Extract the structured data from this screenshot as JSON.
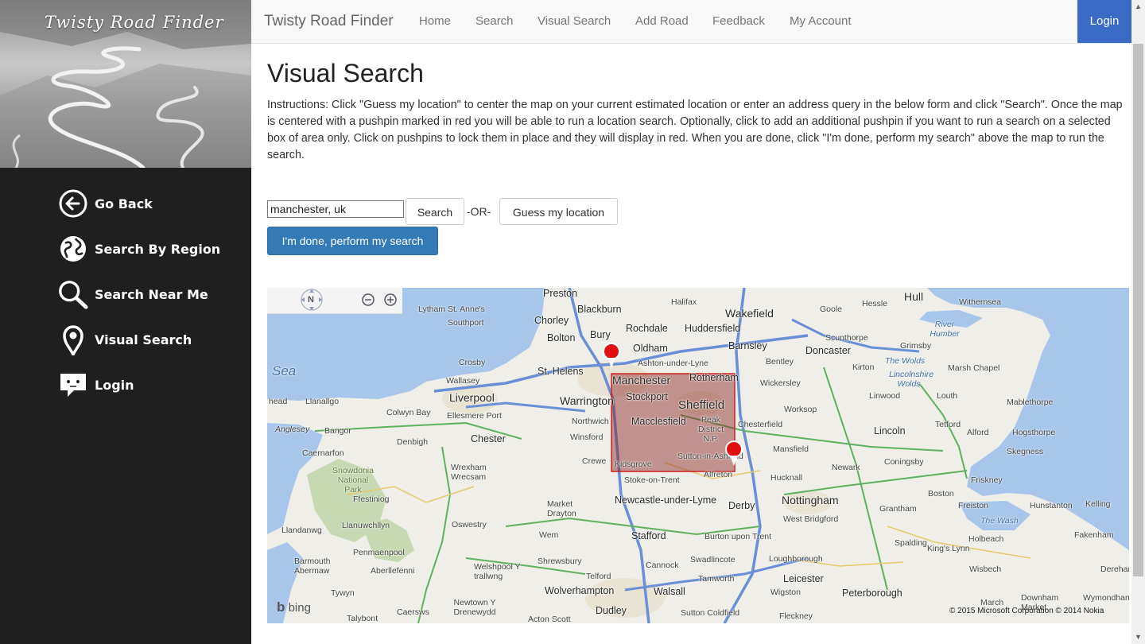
{
  "sidebar": {
    "hero_title": "Twisty Road Finder",
    "items": [
      {
        "label": "Go Back",
        "icon": "back-arrow-icon"
      },
      {
        "label": "Search By Region",
        "icon": "globe-icon"
      },
      {
        "label": "Search Near Me",
        "icon": "search-icon"
      },
      {
        "label": "Visual Search",
        "icon": "map-pin-icon"
      },
      {
        "label": "Login",
        "icon": "chat-bubble-icon"
      }
    ]
  },
  "topbar": {
    "brand": "Twisty Road Finder",
    "links": [
      "Home",
      "Search",
      "Visual Search",
      "Add Road",
      "Feedback",
      "My Account"
    ],
    "login": "Login"
  },
  "main": {
    "title": "Visual Search",
    "instructions": "Instructions: Click \"Guess my location\" to center the map on your current estimated location or enter an address query in the below form and click \"Search\". Once the map is centered with a pushpin marked in red you will be able to run a location search. Optionally, click to add an additional pushpin if you want to run a search on a selected box of area only. Click on pushpins to lock them in place and they will display in red. When you are done, click \"I'm done, perform my search\" above the map to run the search.",
    "address_value": "manchester, uk",
    "search_button": "Search",
    "or_label": "-OR-",
    "guess_button": "Guess my location",
    "done_button": "I'm done, perform my search"
  },
  "map": {
    "compass_label": "N",
    "bing_label": "bing",
    "copyright": "© 2015 Microsoft Corporation   © 2014 Nokia",
    "selection_color": "#8a1f1f",
    "pin_color": "#e01010",
    "places": [
      {
        "name": "Preston"
      },
      {
        "name": "Blackburn"
      },
      {
        "name": "Halifax"
      },
      {
        "name": "Wakefield"
      },
      {
        "name": "Hull"
      },
      {
        "name": "Withernsea"
      },
      {
        "name": "Hessle"
      },
      {
        "name": "Goole"
      },
      {
        "name": "Lytham St. Anne's"
      },
      {
        "name": "Southport"
      },
      {
        "name": "Chorley"
      },
      {
        "name": "Rochdale"
      },
      {
        "name": "Huddersfield"
      },
      {
        "name": "Bury"
      },
      {
        "name": "Bolton"
      },
      {
        "name": "Oldham"
      },
      {
        "name": "Barnsley"
      },
      {
        "name": "Doncaster"
      },
      {
        "name": "Scunthorpe"
      },
      {
        "name": "Grimsby"
      },
      {
        "name": "Crosby"
      },
      {
        "name": "St. Helens"
      },
      {
        "name": "Ashton-under-Lyne"
      },
      {
        "name": "Bentley"
      },
      {
        "name": "Kirton"
      },
      {
        "name": "Marsh Chapel"
      },
      {
        "name": "Sea"
      },
      {
        "name": "Wallasey"
      },
      {
        "name": "Manchester"
      },
      {
        "name": "Rotherham"
      },
      {
        "name": "Wickersley"
      },
      {
        "name": "Liverpool"
      },
      {
        "name": "Warrington"
      },
      {
        "name": "Stockport"
      },
      {
        "name": "Sheffield"
      },
      {
        "name": "Worksop"
      },
      {
        "name": "Linwood"
      },
      {
        "name": "Louth"
      },
      {
        "name": "Mablethorpe"
      },
      {
        "name": "head"
      },
      {
        "name": "Llanallgo"
      },
      {
        "name": "Colwyn Bay"
      },
      {
        "name": "Ellesmere Port"
      },
      {
        "name": "Northwich"
      },
      {
        "name": "Macclesfield"
      },
      {
        "name": "Peak District N.P."
      },
      {
        "name": "Chesterfield"
      },
      {
        "name": "Lincoln"
      },
      {
        "name": "Tetford"
      },
      {
        "name": "Alford"
      },
      {
        "name": "Hogsthorpe"
      },
      {
        "name": "Anglesey"
      },
      {
        "name": "Bangor"
      },
      {
        "name": "Denbigh"
      },
      {
        "name": "Chester"
      },
      {
        "name": "Winsford"
      },
      {
        "name": "Caernarfon"
      },
      {
        "name": "Crewe"
      },
      {
        "name": "Kidsgrove"
      },
      {
        "name": "Sutton-in-Ashfield"
      },
      {
        "name": "Mansfield"
      },
      {
        "name": "Coningsby"
      },
      {
        "name": "Skegness"
      },
      {
        "name": "Snowdonia National Park"
      },
      {
        "name": "Wrexham Wrecsam"
      },
      {
        "name": "Stoke-on-Trent"
      },
      {
        "name": "Alfreton"
      },
      {
        "name": "Hucknall"
      },
      {
        "name": "Newark"
      },
      {
        "name": "Friskney"
      },
      {
        "name": "Ffestiniog"
      },
      {
        "name": "Newcastle-under-Lyme"
      },
      {
        "name": "Derby"
      },
      {
        "name": "Nottingham"
      },
      {
        "name": "Boston"
      },
      {
        "name": "Market Drayton"
      },
      {
        "name": "Grantham"
      },
      {
        "name": "Freiston"
      },
      {
        "name": "Hunstanton"
      },
      {
        "name": "Kelling"
      },
      {
        "name": "Llandanwg"
      },
      {
        "name": "Llanuwchllyn"
      },
      {
        "name": "Oswestry"
      },
      {
        "name": "West Bridgford"
      },
      {
        "name": "The Wash"
      },
      {
        "name": "Wem"
      },
      {
        "name": "Stafford"
      },
      {
        "name": "Burton upon Trent"
      },
      {
        "name": "Spalding"
      },
      {
        "name": "Holbeach"
      },
      {
        "name": "Fakenham"
      },
      {
        "name": "Penmaenpool"
      },
      {
        "name": "Loughborough"
      },
      {
        "name": "King's Lynn"
      },
      {
        "name": "Barmouth Abermaw"
      },
      {
        "name": "Shrewsbury"
      },
      {
        "name": "Cannock"
      },
      {
        "name": "Swadlincote"
      },
      {
        "name": "Aberllefenni"
      },
      {
        "name": "Welshpool Y trallwng"
      },
      {
        "name": "Telford"
      },
      {
        "name": "Tamworth"
      },
      {
        "name": "Leicester"
      },
      {
        "name": "Wisbech"
      },
      {
        "name": "Dereham"
      },
      {
        "name": "Tywyn"
      },
      {
        "name": "Wolverhampton"
      },
      {
        "name": "Walsall"
      },
      {
        "name": "Wigston"
      },
      {
        "name": "Peterborough"
      },
      {
        "name": "Downham Market"
      },
      {
        "name": "Wymondham"
      },
      {
        "name": "Newtown Y Drenewydd"
      },
      {
        "name": "Caersws"
      },
      {
        "name": "Dudley"
      },
      {
        "name": "Sutton Coldfield"
      },
      {
        "name": "March"
      },
      {
        "name": "Talybont"
      },
      {
        "name": "Acton Scott"
      },
      {
        "name": "Fleckney"
      },
      {
        "name": "The Wolds"
      },
      {
        "name": "Lincolnshire Wolds"
      },
      {
        "name": "River Humber"
      }
    ]
  }
}
